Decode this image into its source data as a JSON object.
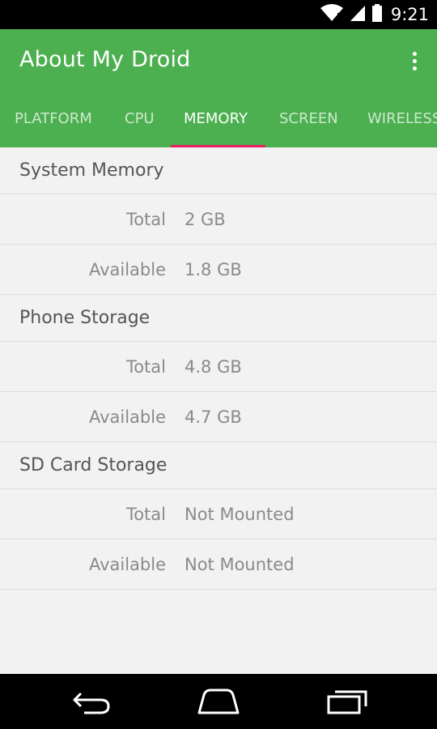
{
  "status_bar": {
    "time": "9:21",
    "icons": [
      "wifi-icon",
      "signal-icon",
      "battery-icon"
    ]
  },
  "app_bar": {
    "title": "About My Droid",
    "background_color": "#4caf50",
    "indicator_color": "#e91e63",
    "overflow_icon": "more-vert-icon"
  },
  "tabs": [
    {
      "label": "PLATFORM",
      "active": false
    },
    {
      "label": "CPU",
      "active": false
    },
    {
      "label": "MEMORY",
      "active": true
    },
    {
      "label": "SCREEN",
      "active": false
    },
    {
      "label": "WIRELESS",
      "active": false
    }
  ],
  "sections": [
    {
      "title": "System Memory",
      "rows": [
        {
          "label": "Total",
          "value": "2 GB"
        },
        {
          "label": "Available",
          "value": "1.8 GB"
        }
      ]
    },
    {
      "title": "Phone Storage",
      "rows": [
        {
          "label": "Total",
          "value": "4.8 GB"
        },
        {
          "label": "Available",
          "value": "4.7 GB"
        }
      ]
    },
    {
      "title": "SD Card Storage",
      "rows": [
        {
          "label": "Total",
          "value": "Not Mounted"
        },
        {
          "label": "Available",
          "value": "Not Mounted"
        }
      ]
    }
  ],
  "nav_bar": {
    "buttons": [
      "back-icon",
      "home-icon",
      "recents-icon"
    ]
  }
}
